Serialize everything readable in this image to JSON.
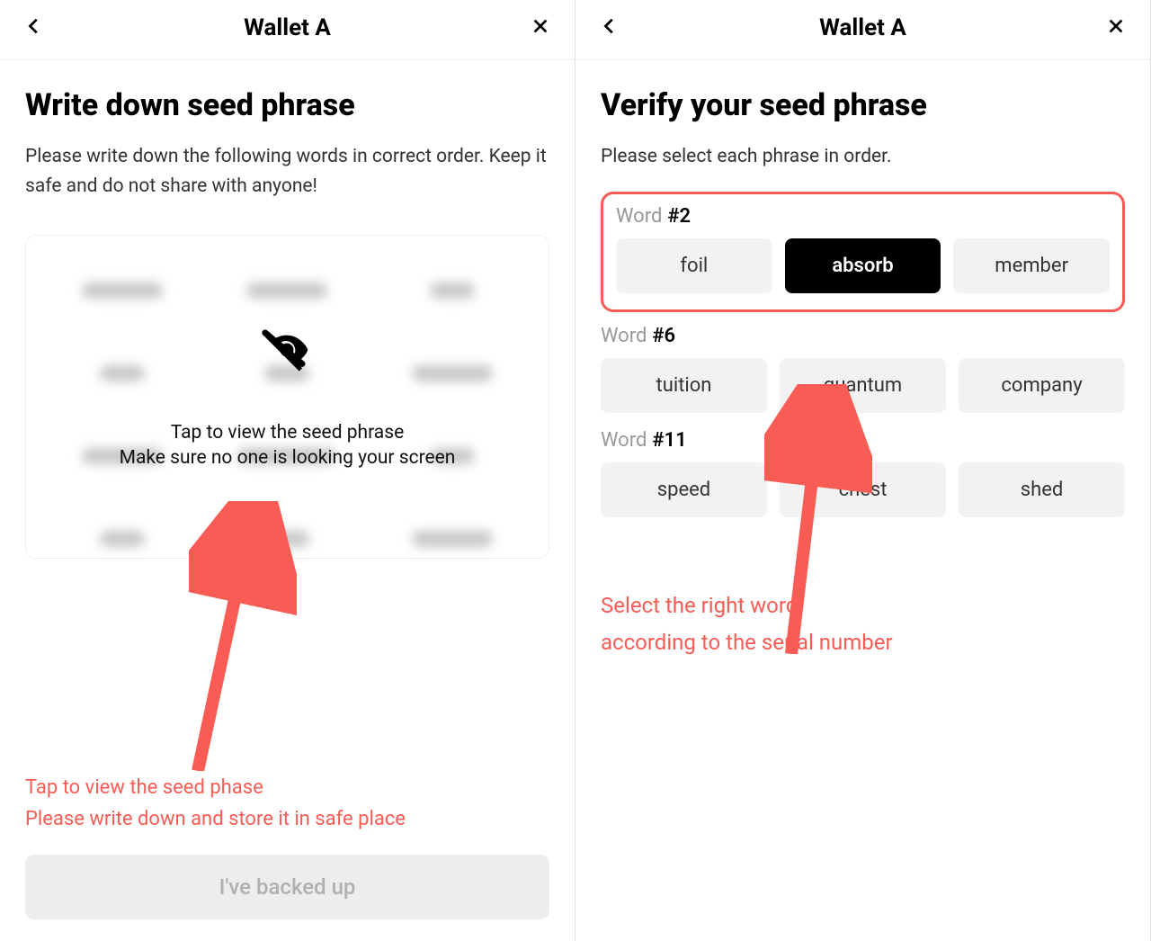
{
  "left": {
    "header_title": "Wallet A",
    "title": "Write down seed phrase",
    "subtitle": "Please write down the following words in correct order. Keep it safe and do not share with anyone!",
    "tap_title": "Tap to view the seed phrase",
    "tap_sub": "Make sure no one is looking your screen",
    "annotation_line1": "Tap to view the seed phase",
    "annotation_line2": "Please write down and store it in safe place",
    "primary_button": "I've backed up"
  },
  "right": {
    "header_title": "Wallet A",
    "title": "Verify your seed phrase",
    "subtitle": "Please select each phrase in order.",
    "groups": [
      {
        "label_prefix": "Word",
        "label_hash": "#2",
        "options": [
          "foil",
          "absorb",
          "member"
        ],
        "selected_index": 1,
        "highlighted": true
      },
      {
        "label_prefix": "Word",
        "label_hash": "#6",
        "options": [
          "tuition",
          "quantum",
          "company"
        ],
        "selected_index": null,
        "highlighted": false
      },
      {
        "label_prefix": "Word",
        "label_hash": "#11",
        "options": [
          "speed",
          "chest",
          "shed"
        ],
        "selected_index": null,
        "highlighted": false
      }
    ],
    "annotation_line1": "Select the right word",
    "annotation_line2": "according to the serial number"
  },
  "icons": {
    "back": "back-icon",
    "close": "close-icon",
    "eye_slash": "eye-slash-icon"
  },
  "colors": {
    "accent_red": "#f95c54",
    "grey_chip": "#f2f2f2",
    "disabled_btn_bg": "#ededed",
    "disabled_btn_fg": "#b0b0b0"
  }
}
